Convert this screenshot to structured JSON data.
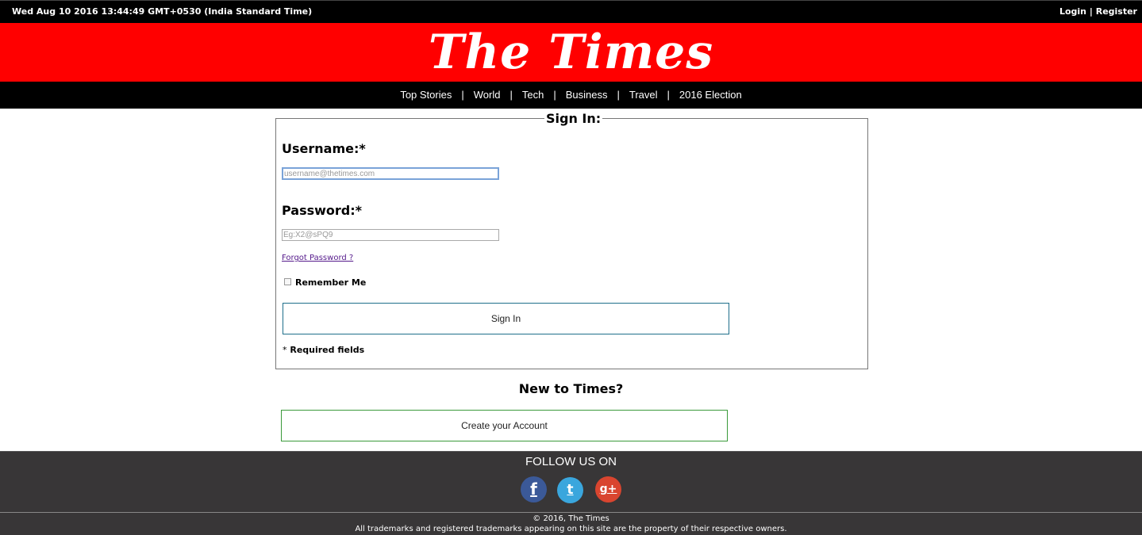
{
  "topbar": {
    "datetime": "Wed Aug 10 2016 13:44:49 GMT+0530 (India Standard Time)",
    "login": "Login",
    "separator": "|",
    "register": "Register"
  },
  "masthead": {
    "logo_text": "The Times"
  },
  "nav": {
    "items": [
      "Top Stories",
      "World",
      "Tech",
      "Business",
      "Travel",
      "2016 Election"
    ],
    "separator": "|"
  },
  "signin": {
    "legend": "Sign In:",
    "username_label": "Username:*",
    "username_placeholder": "username@thetimes.com",
    "password_label": "Password:*",
    "password_placeholder": "Eg:X2@sPQ9",
    "forgot_password": "Forgot Password ?",
    "remember_me": "Remember Me",
    "remember_checked": false,
    "submit_label": "Sign In",
    "required_star": "*",
    "required_text": "Required fields"
  },
  "register": {
    "heading": "New to Times?",
    "create_label": "Create your Account"
  },
  "footer": {
    "follow": "FOLLOW US ON",
    "social": [
      {
        "name": "facebook",
        "glyph": "f",
        "color": "#3b5998"
      },
      {
        "name": "twitter",
        "glyph": "t",
        "color": "#3aa6dd"
      },
      {
        "name": "google-plus",
        "glyph": "g+",
        "color": "#d9452f"
      }
    ],
    "copyright": "© 2016, The Times",
    "trademark": "All trademarks and registered trademarks appearing on this site are the property of their respective owners."
  },
  "colors": {
    "masthead_bg": "#ff0000",
    "bars_bg": "#000000",
    "footer_bg": "#383637",
    "signin_button_border": "#1f6f8b",
    "create_button_border": "#3a9a3a"
  }
}
